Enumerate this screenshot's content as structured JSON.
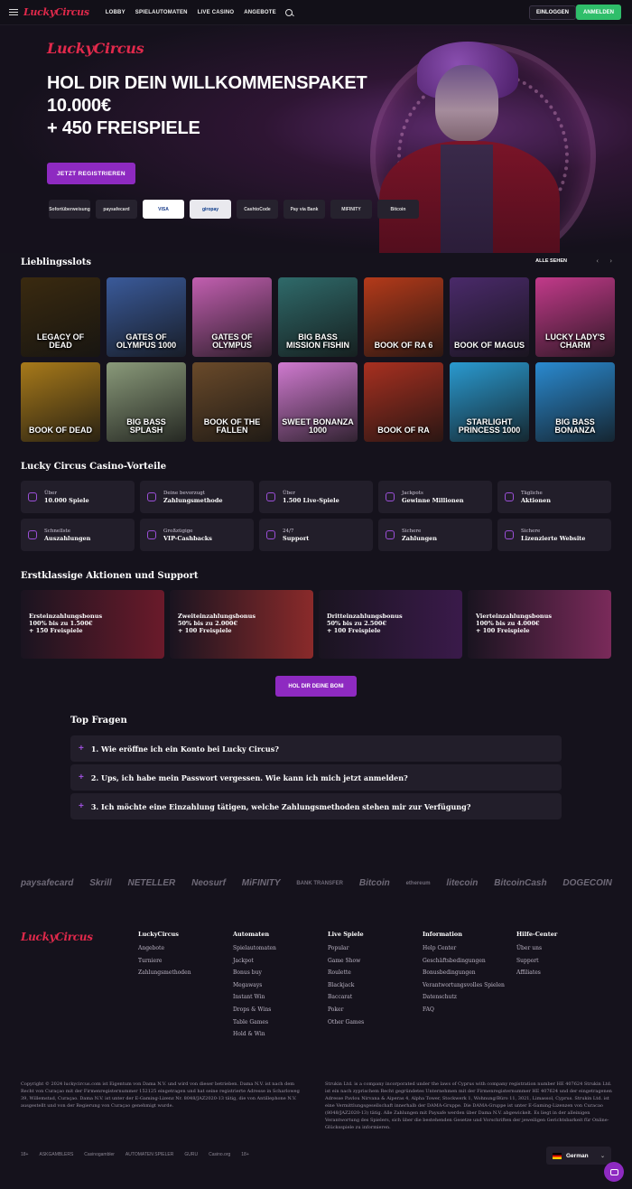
{
  "header": {
    "logo": "LuckyCircus",
    "nav": [
      "LOBBY",
      "SPIELAUTOMATEN",
      "LIVE CASINO",
      "ANGEBOTE"
    ],
    "login_label": "EINLOGGEN",
    "register_label": "ANMELDEN"
  },
  "hero": {
    "logo": "LuckyCircus",
    "title_line1": "HOL DIR DEIN WILLKOMMENSPAKET",
    "title_line2": "10.000€",
    "title_line3": "+ 450 FREISPIELE",
    "cta": "JETZT REGISTRIEREN",
    "payments": [
      "Sofortüberweisung",
      "paysafecard",
      "VISA",
      "giropay",
      "CashtoCode",
      "Pay via Bank",
      "MIFINITY",
      "Bitcoin"
    ]
  },
  "slots": {
    "title": "Lieblingsslots",
    "see_all": "ALLE SEHEN",
    "games": [
      {
        "name": "Legacy of Dead",
        "bg": "#3a2a10"
      },
      {
        "name": "Gates of Olympus 1000",
        "bg": "#3a5a9a"
      },
      {
        "name": "Gates of Olympus",
        "bg": "#c25fb0"
      },
      {
        "name": "Big Bass Mission Fishin",
        "bg": "#2f6a6a"
      },
      {
        "name": "Book of Ra 6",
        "bg": "#b43a1a"
      },
      {
        "name": "Book of Magus",
        "bg": "#4a2a6a"
      },
      {
        "name": "Lucky Lady's Charm",
        "bg": "#c23a8a"
      },
      {
        "name": "Book of Dead",
        "bg": "#a87a1a"
      },
      {
        "name": "Big Bass Splash",
        "bg": "#8a9a7a"
      },
      {
        "name": "Book of the Fallen",
        "bg": "#6a4a2a"
      },
      {
        "name": "Sweet Bonanza 1000",
        "bg": "#d07ad0"
      },
      {
        "name": "Book of Ra",
        "bg": "#a83020"
      },
      {
        "name": "Starlight Princess 1000",
        "bg": "#2a9ad0"
      },
      {
        "name": "Big Bass Bonanza",
        "bg": "#2a8ad0"
      }
    ]
  },
  "advantages": {
    "title": "Lucky Circus Casino-Vorteile",
    "items": [
      {
        "small": "Über",
        "big": "10.000 Spiele"
      },
      {
        "small": "Deine bevorzugt",
        "big": "Zahlungsmethode"
      },
      {
        "small": "Über",
        "big": "1.500 Live-Spiele"
      },
      {
        "small": "Jackpots",
        "big": "Gewinne Millionen"
      },
      {
        "small": "Tägliche",
        "big": "Aktionen"
      },
      {
        "small": "Schnellste",
        "big": "Auszahlungen"
      },
      {
        "small": "Großzügige",
        "big": "VIP-Cashbacks"
      },
      {
        "small": "24/7",
        "big": "Support"
      },
      {
        "small": "Sichere",
        "big": "Zahlungen"
      },
      {
        "small": "Sichere",
        "big": "Lizenzierte Website"
      }
    ]
  },
  "promos": {
    "title": "Erstklassige Aktionen und Support",
    "items": [
      {
        "title": "Ersteinzahlungsbonus",
        "line1": "100% bis zu 1.500€",
        "line2": "+ 150 Freispiele",
        "bg": "#6a1a2a"
      },
      {
        "title": "Zweiteinzahlungsbonus",
        "line1": "50% bis zu 2.000€",
        "line2": "+ 100 Freispiele",
        "bg": "#8a2a2a"
      },
      {
        "title": "Dritteinzahlungsbonus",
        "line1": "50% bis zu 2.500€",
        "line2": "+ 100 Freispiele",
        "bg": "#3a1a4a"
      },
      {
        "title": "Vierteinzahlungsbonus",
        "line1": "100% bis zu 4.000€",
        "line2": "+ 100 Freispiele",
        "bg": "#7a2a5a"
      }
    ],
    "cta": "HOL DIR DEINE BONI"
  },
  "faq": {
    "title": "Top Fragen",
    "items": [
      "1. Wie eröffne ich ein Konto bei Lucky Circus?",
      "2. Ups, ich habe mein Passwort vergessen. Wie kann ich mich jetzt anmelden?",
      "3. Ich möchte eine Einzahlung tätigen, welche Zahlungsmethoden stehen mir zur Verfügung?"
    ]
  },
  "partners": [
    "paysafecard",
    "Skrill",
    "NETELLER",
    "Neosurf",
    "MiFINITY",
    "BANK TRANSFER",
    "Bitcoin",
    "ethereum",
    "litecoin",
    "BitcoinCash",
    "DOGECOIN"
  ],
  "footer": {
    "logo": "LuckyCircus",
    "columns": [
      {
        "head": "LuckyCircus",
        "items": [
          "Angebote",
          "Turniere",
          "Zahlungsmethoden"
        ]
      },
      {
        "head": "Automaten",
        "items": [
          "Spielautomaten",
          "Jackpot",
          "Bonus buy",
          "Megaways",
          "Instant Win",
          "Drops & Wins",
          "Table Games",
          "Hold & Win"
        ]
      },
      {
        "head": "Live Spiele",
        "items": [
          "Popular",
          "Game Show",
          "Roulette",
          "Blackjack",
          "Baccarat",
          "Poker",
          "Other Games"
        ]
      },
      {
        "head": "Information",
        "items": [
          "Help Center",
          "Geschäftsbedingungen",
          "Bonusbedingungen",
          "Verantwortungsvolles Spielen",
          "Datenschutz",
          "FAQ"
        ]
      },
      {
        "head": "Hilfe-Center",
        "items": [
          "Über uns",
          "Support",
          "Affiliates"
        ]
      }
    ],
    "legal_left": "Copyright © 2024 luckycircus.com ist Eigentum von Dama N.V. und wird von dieser betrieben. Dama N.V. ist nach dem Recht von Curaçao mit der Firmenregisternummer 152125 eingetragen und hat seine registrierte Adresse in Scharloweg 39, Willemstad, Curaçao. Dama N.V. ist unter der E-Gaming-Lizenz Nr. 8048/JAZ2020-13 tätig, die von Antillephone N.V. ausgestellt und von der Regierung von Curaçao genehmigt wurde.",
    "legal_right": "Strukin Ltd. is a company incorporated under the laws of Cyprus with company registration number HE 407624 Strukin Ltd. ist ein nach zyprischem Recht gegründetes Unternehmen mit der Firmenregisternummer HE 407624 und der eingetragenen Adresse Pavlou Nirvana & Aiperas 4, Alpha Tower, Stockwerk 1, Wohnung/Büro 11, 3021, Limassol, Cyprus. Strukin Ltd. ist eine Vermittlungsgesellschaft innerhalb der DAMA-Gruppe. Die DAMA-Gruppe ist unter E-Gaming-Lizenzen von Curacao (8048/JAZ2020-13) tätig. Alle Zahlungen mit Paysafe werden über Dama N.V. abgewickelt. Es liegt in der alleinigen Verantwortung des Spielers, sich über die bestehenden Gesetze und Vorschriften der jeweiligen Gerichtsbarkeit für Online-Glücksspiele zu informieren.",
    "bottom_logos": [
      "18+",
      "ASKGAMBLERS",
      "Casinogambler",
      "AUTOMATEN SPIELER",
      "GURU",
      "Casino.org",
      "18+"
    ],
    "language": "German"
  }
}
